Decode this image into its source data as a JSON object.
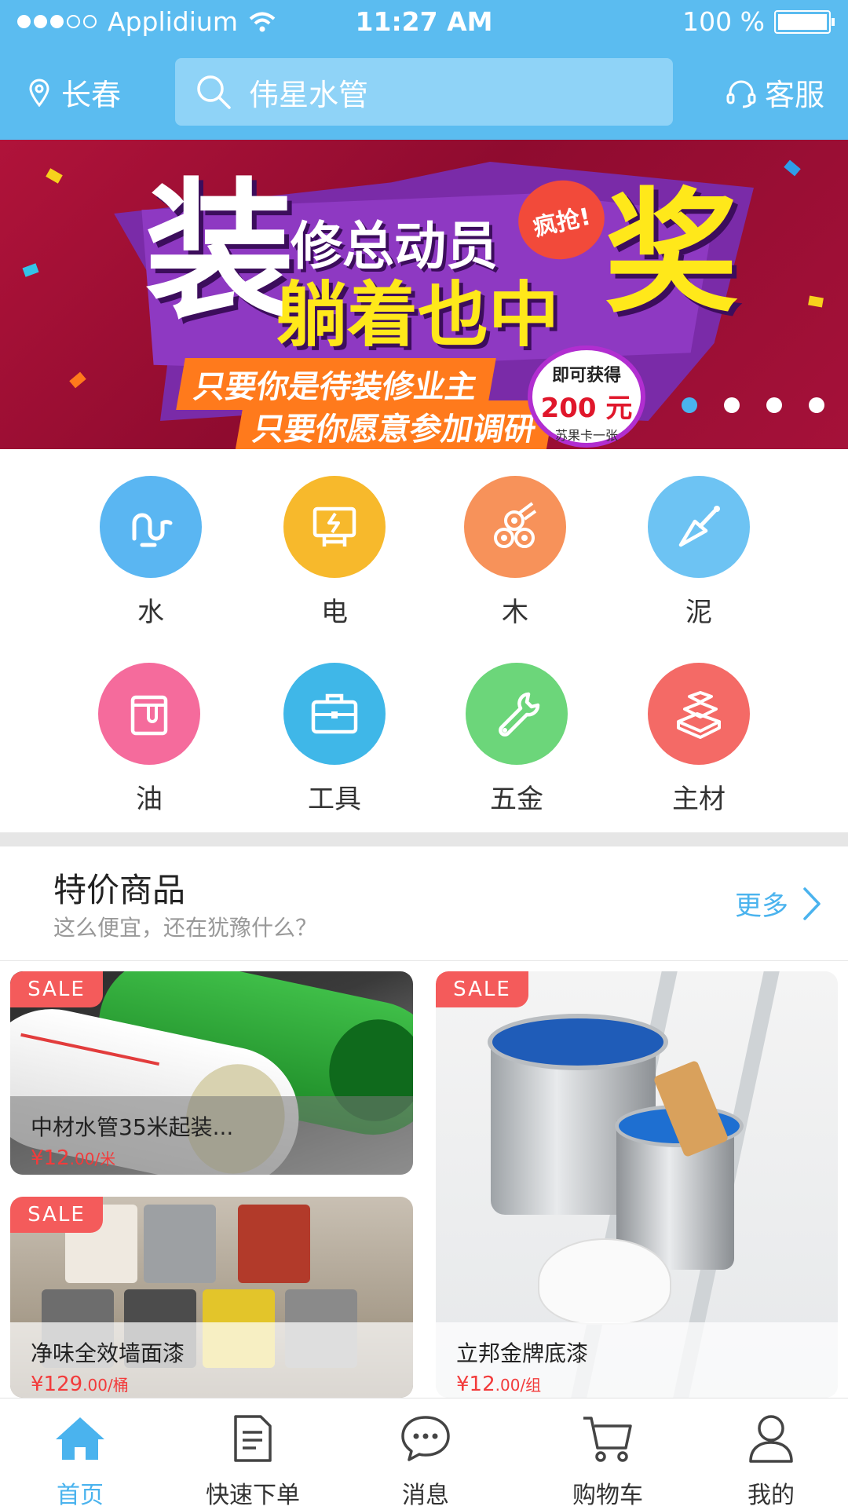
{
  "status_bar": {
    "carrier": "Applidium",
    "time": "11:27 AM",
    "battery": "100 %"
  },
  "header": {
    "city": "长春",
    "search_text": "伟星水管",
    "service_label": "客服"
  },
  "banner": {
    "big_char": "装",
    "line1": "修总动员",
    "line2": "躺着也中",
    "mega_char": "奖",
    "tag": "疯抢!",
    "slogan1": "只要你是待装修业主",
    "slogan2": "只要你愿意参加调研",
    "prize_line1": "即可获得",
    "prize_line2": "200 元",
    "prize_line3": "苏果卡一张",
    "pages": 4,
    "active_page": 1
  },
  "categories": [
    {
      "label": "水",
      "icon": "water-pipe-icon",
      "color": "#5ab6f2"
    },
    {
      "label": "电",
      "icon": "electric-panel-icon",
      "color": "#f7b92c"
    },
    {
      "label": "木",
      "icon": "wood-logs-icon",
      "color": "#f7925a"
    },
    {
      "label": "泥",
      "icon": "trowel-icon",
      "color": "#6dc3f3"
    },
    {
      "label": "油",
      "icon": "paint-bucket-icon",
      "color": "#f56b9c"
    },
    {
      "label": "工具",
      "icon": "toolbox-icon",
      "color": "#3fb7e8"
    },
    {
      "label": "五金",
      "icon": "wrench-icon",
      "color": "#6cd67a"
    },
    {
      "label": "主材",
      "icon": "materials-stack-icon",
      "color": "#f46a66"
    }
  ],
  "specials": {
    "title": "特价商品",
    "subtitle": "这么便宜，还在犹豫什么？",
    "more_label": "更多",
    "sale_badge": "SALE",
    "products": [
      {
        "name": "中材水管35米起装...",
        "price": "¥12",
        "price_unit": ".00/米"
      },
      {
        "name": "立邦金牌底漆",
        "price": "¥12",
        "price_unit": ".00/组"
      },
      {
        "name": "净味全效墙面漆",
        "price": "¥129",
        "price_unit": ".00/桶"
      }
    ]
  },
  "tabbar": {
    "items": [
      {
        "label": "首页",
        "icon": "home-icon",
        "active": true
      },
      {
        "label": "快速下单",
        "icon": "document-icon",
        "active": false
      },
      {
        "label": "消息",
        "icon": "chat-bubble-icon",
        "active": false
      },
      {
        "label": "购物车",
        "icon": "cart-icon",
        "active": false
      },
      {
        "label": "我的",
        "icon": "user-icon",
        "active": false
      }
    ],
    "active_color": "#4ab3ee"
  }
}
